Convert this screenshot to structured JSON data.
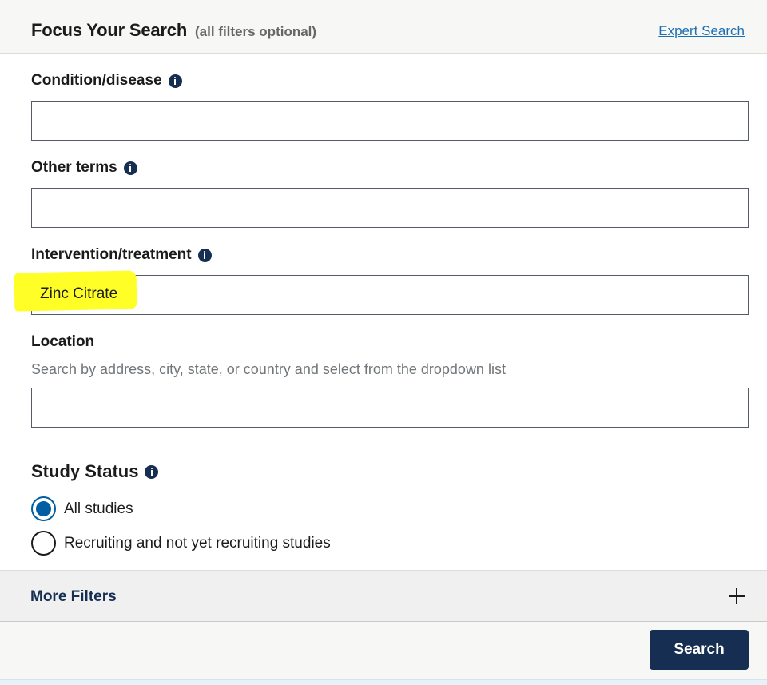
{
  "header": {
    "title": "Focus Your Search",
    "subtitle": "(all filters optional)",
    "expert_link": "Expert Search"
  },
  "fields": {
    "condition": {
      "label": "Condition/disease",
      "value": "",
      "icon": "info-icon"
    },
    "other_terms": {
      "label": "Other terms",
      "value": "",
      "icon": "info-icon"
    },
    "intervention": {
      "label": "Intervention/treatment",
      "value": "Zinc Citrate",
      "icon": "info-icon"
    },
    "location": {
      "label": "Location",
      "hint": "Search by address, city, state, or country and select from the dropdown list",
      "value": ""
    }
  },
  "study_status": {
    "title": "Study Status",
    "options": [
      {
        "label": "All studies",
        "selected": true
      },
      {
        "label": "Recruiting and not yet recruiting studies",
        "selected": false
      }
    ]
  },
  "more_filters": {
    "label": "More Filters",
    "icon": "plus-icon"
  },
  "footer": {
    "search_label": "Search"
  },
  "colors": {
    "primary_dark": "#162e51",
    "link": "#1a6fb5",
    "radio_selected": "#005ea2",
    "highlight": "#fffe26"
  }
}
